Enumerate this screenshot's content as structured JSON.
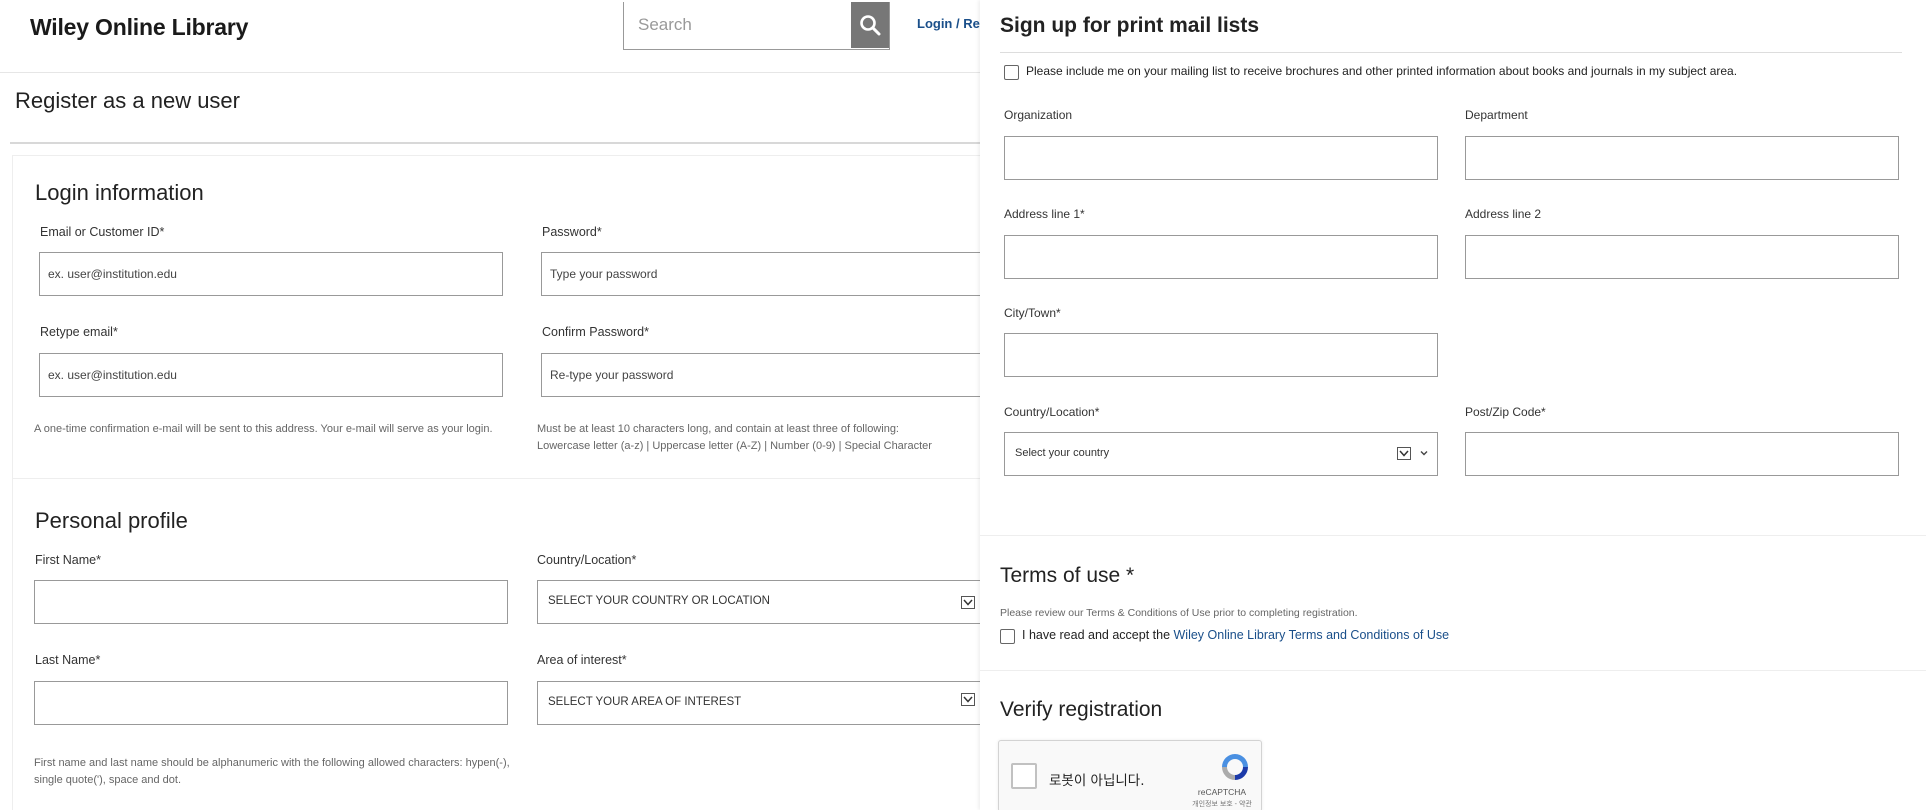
{
  "header": {
    "brand": "Wiley Online Library",
    "search_placeholder": "Search",
    "login_link": "Login / Re"
  },
  "page": {
    "title": "Register as a new user"
  },
  "login_info": {
    "heading": "Login information",
    "email_label": "Email or Customer ID*",
    "email_placeholder": "ex. user@institution.edu",
    "password_label": "Password*",
    "password_placeholder": "Type your password",
    "retype_email_label": "Retype email*",
    "retype_email_placeholder": "ex. user@institution.edu",
    "confirm_password_label": "Confirm Password*",
    "confirm_password_placeholder": "Re-type your password",
    "email_help": "A one-time confirmation e-mail will be sent to this address. Your e-mail will serve as your login.",
    "password_help_line1": "Must be at least 10 characters long, and contain at least three of following:",
    "password_help_line2": "Lowercase letter (a-z) | Uppercase letter (A-Z) | Number (0-9) | Special Character"
  },
  "personal_profile": {
    "heading": "Personal profile",
    "first_name_label": "First Name*",
    "country_label": "Country/Location*",
    "country_value": "SELECT YOUR COUNTRY OR LOCATION",
    "last_name_label": "Last Name*",
    "interest_label": "Area of interest*",
    "interest_value": "SELECT YOUR AREA OF INTEREST",
    "name_help": "First name and last name should be alphanumeric with the following allowed characters: hypen(-), single quote('), space and dot."
  },
  "print_mail": {
    "heading": "Sign up for print mail lists",
    "mailing_checkbox_label": "Please include me on your mailing list to receive brochures and other printed information about books and journals in my subject area.",
    "organization_label": "Organization",
    "department_label": "Department",
    "address1_label": "Address line 1*",
    "address2_label": "Address line 2",
    "city_label": "City/Town*",
    "country_label": "Country/Location*",
    "country_value": "Select your country",
    "postcode_label": "Post/Zip Code*"
  },
  "terms": {
    "heading": "Terms of use *",
    "review_text": "Please review our Terms & Conditions of Use prior to completing registration.",
    "accept_prefix": "I have read and accept the ",
    "accept_link": "Wiley Online Library Terms and Conditions of Use"
  },
  "verify": {
    "heading": "Verify registration",
    "captcha_label": "로봇이 아닙니다.",
    "captcha_brand": "reCAPTCHA",
    "captcha_links": "개인정보 보호 - 약관"
  },
  "colors": {
    "link": "#1a4f8a",
    "search_button": "#777777",
    "border": "#999999"
  }
}
